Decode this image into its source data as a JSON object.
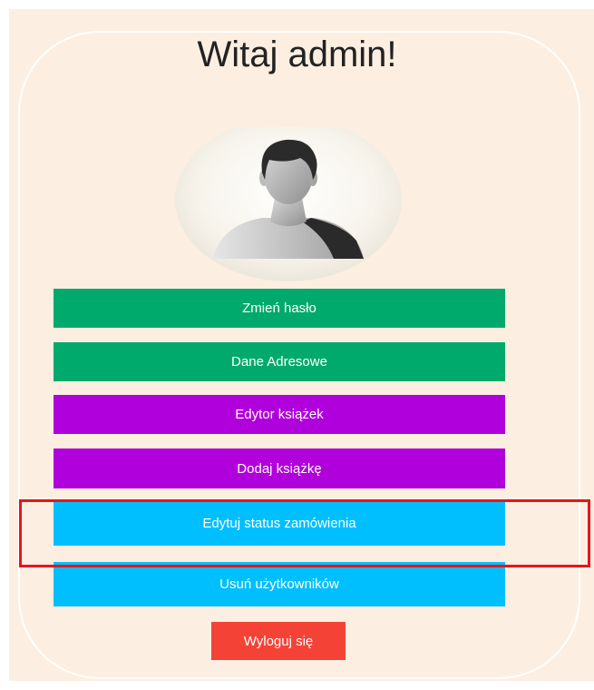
{
  "greeting": "Witaj admin!",
  "avatar": {
    "icon": "user-avatar-icon"
  },
  "menu": {
    "change_password": "Zmień hasło",
    "address_data": "Dane Adresowe",
    "book_editor": "Edytor książek",
    "add_book": "Dodaj książkę",
    "edit_order_status": "Edytuj status zamówienia",
    "delete_users": "Usuń użytkowników"
  },
  "logout": "Wyloguj się",
  "colors": {
    "background": "#fcefe1",
    "green": "#00aa6c",
    "purple": "#b000db",
    "blue": "#00bfff",
    "logout": "#f44336",
    "highlight": "#e8141e"
  }
}
